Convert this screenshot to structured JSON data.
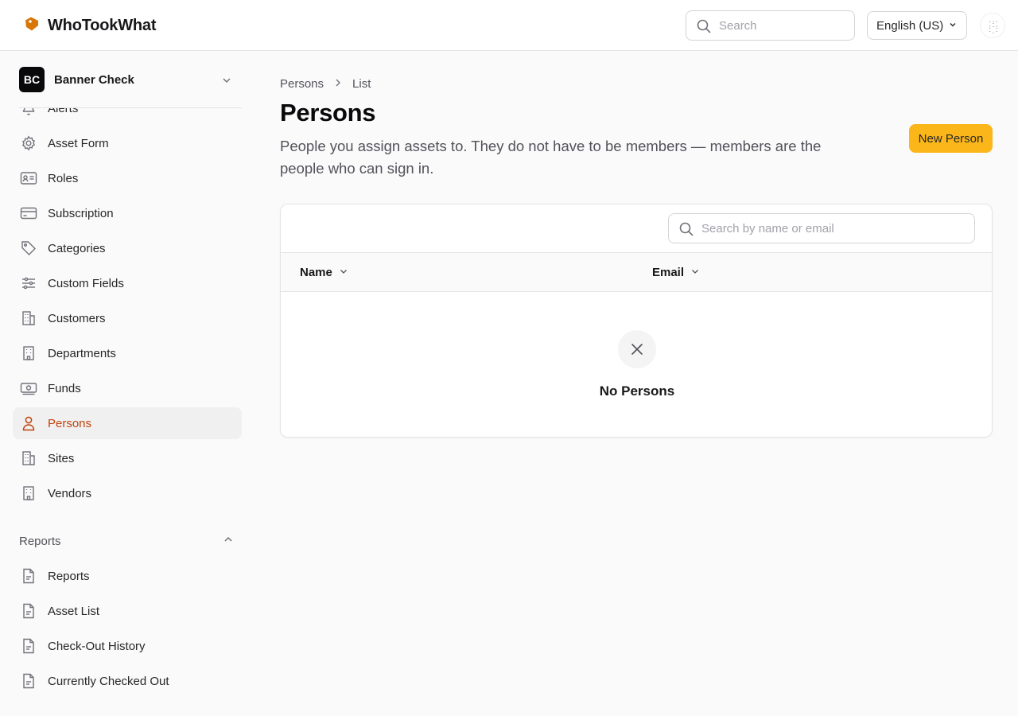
{
  "colors": {
    "accent": "#c2410c",
    "button": "#fbb619",
    "brand_icon": "#d97706"
  },
  "header": {
    "app_name": "WhoTookWhat",
    "search_placeholder": "Search",
    "language": "English (US)"
  },
  "sidebar": {
    "org_initials": "BC",
    "org_name": "Banner Check",
    "items": [
      {
        "label": "Alerts",
        "icon": "bell-icon"
      },
      {
        "label": "Asset Form",
        "icon": "gear-icon"
      },
      {
        "label": "Roles",
        "icon": "id-card-icon"
      },
      {
        "label": "Subscription",
        "icon": "credit-card-icon"
      },
      {
        "label": "Categories",
        "icon": "tag-icon"
      },
      {
        "label": "Custom Fields",
        "icon": "sliders-icon"
      },
      {
        "label": "Customers",
        "icon": "building-icon"
      },
      {
        "label": "Departments",
        "icon": "building-icon"
      },
      {
        "label": "Funds",
        "icon": "banknote-icon"
      },
      {
        "label": "Persons",
        "icon": "user-icon",
        "active": true
      },
      {
        "label": "Sites",
        "icon": "building-icon"
      },
      {
        "label": "Vendors",
        "icon": "building-icon"
      }
    ],
    "reports_section": {
      "label": "Reports",
      "items": [
        {
          "label": "Reports",
          "icon": "file-icon"
        },
        {
          "label": "Asset List",
          "icon": "file-icon"
        },
        {
          "label": "Check-Out History",
          "icon": "file-icon"
        },
        {
          "label": "Currently Checked Out",
          "icon": "file-icon"
        }
      ]
    }
  },
  "main": {
    "breadcrumb": [
      "Persons",
      "List"
    ],
    "title": "Persons",
    "description": "People you assign assets to. They do not have to be members — members are the people who can sign in.",
    "new_button": "New Person",
    "table": {
      "search_placeholder": "Search by name or email",
      "columns": [
        "Name",
        "Email"
      ],
      "empty_text": "No Persons"
    }
  }
}
